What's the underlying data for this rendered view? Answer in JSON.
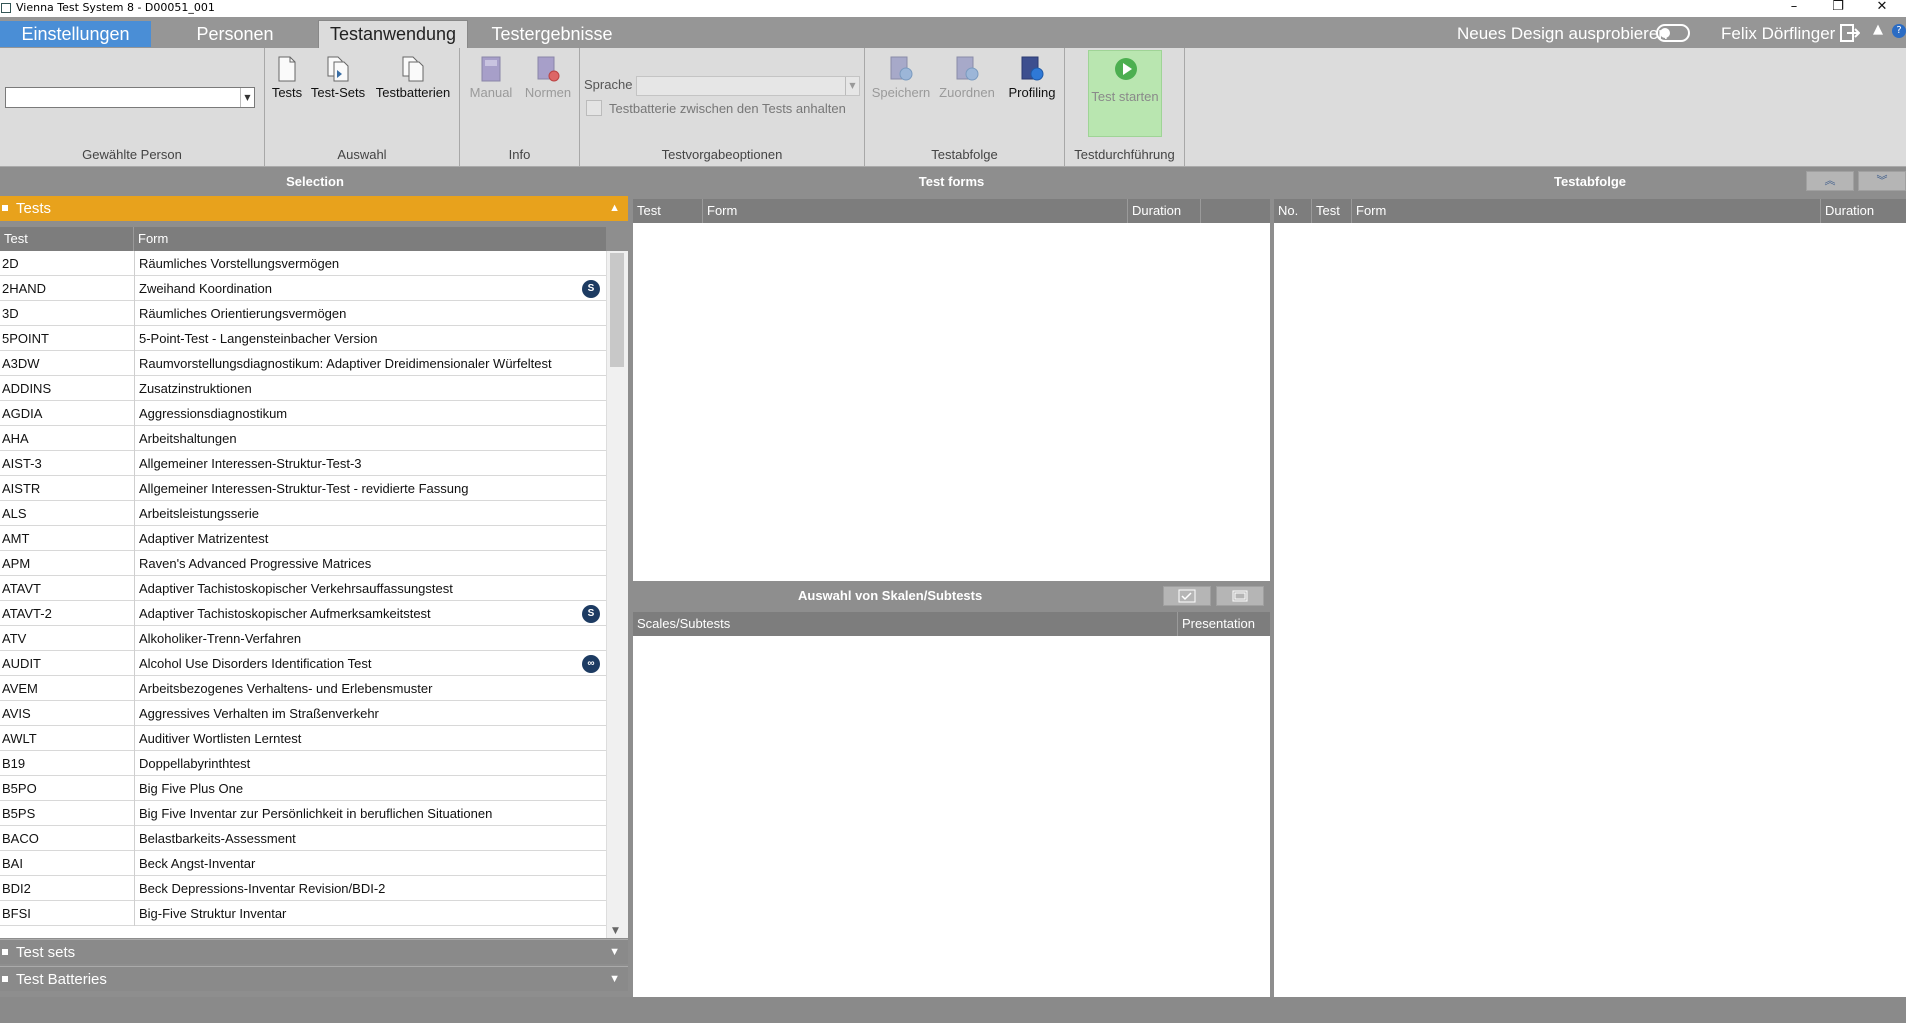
{
  "window": {
    "title": "Vienna Test System 8 - D00051_001",
    "minimize": "–",
    "restore": "❐",
    "close": "✕"
  },
  "tabs": {
    "settings": "Einstellungen",
    "persons": "Personen",
    "test_application": "Testanwendung",
    "results": "Testergebnisse"
  },
  "topright": {
    "new_design": "Neues Design ausprobieren",
    "user": "Felix Dörflinger",
    "logout_icon": "logout-icon",
    "help_icon": "?"
  },
  "ribbon": {
    "person": {
      "label": "Gewählte Person",
      "value": ""
    },
    "selection": {
      "label": "Auswahl",
      "tests": "Tests",
      "test_sets": "Test-Sets",
      "test_batteries": "Testbatterien"
    },
    "info": {
      "label": "Info",
      "manual": "Manual",
      "norms": "Normen"
    },
    "options": {
      "label": "Testvorgabeoptionen",
      "language_label": "Sprache",
      "language_value": "",
      "pause_label": "Testbatterie zwischen den Tests anhalten"
    },
    "sequence": {
      "label": "Testabfolge",
      "save": "Speichern",
      "assign": "Zuordnen",
      "profiling": "Profiling"
    },
    "execution": {
      "label": "Testdurchführung",
      "start": "Test starten"
    }
  },
  "selection_panel": {
    "header": "Selection",
    "tests_section": "Tests",
    "col_test": "Test",
    "col_form": "Form",
    "rows": [
      {
        "code": "2D",
        "form": "Räumliches Vorstellungsvermögen",
        "badge": ""
      },
      {
        "code": "2HAND",
        "form": "Zweihand Koordination",
        "badge": "S"
      },
      {
        "code": "3D",
        "form": "Räumliches Orientierungsvermögen",
        "badge": ""
      },
      {
        "code": "5POINT",
        "form": "5-Point-Test - Langensteinbacher Version",
        "badge": ""
      },
      {
        "code": "A3DW",
        "form": "Raumvorstellungsdiagnostikum: Adaptiver Dreidimensionaler Würfeltest",
        "badge": ""
      },
      {
        "code": "ADDINS",
        "form": "Zusatzinstruktionen",
        "badge": ""
      },
      {
        "code": "AGDIA",
        "form": "Aggressionsdiagnostikum",
        "badge": ""
      },
      {
        "code": "AHA",
        "form": "Arbeitshaltungen",
        "badge": ""
      },
      {
        "code": "AIST-3",
        "form": "Allgemeiner Interessen-Struktur-Test-3",
        "badge": ""
      },
      {
        "code": "AISTR",
        "form": "Allgemeiner Interessen-Struktur-Test - revidierte Fassung",
        "badge": ""
      },
      {
        "code": "ALS",
        "form": "Arbeitsleistungsserie",
        "badge": ""
      },
      {
        "code": "AMT",
        "form": "Adaptiver Matrizentest",
        "badge": ""
      },
      {
        "code": "APM",
        "form": "Raven's Advanced Progressive Matrices",
        "badge": ""
      },
      {
        "code": "ATAVT",
        "form": "Adaptiver Tachistoskopischer Verkehrsauffassungstest",
        "badge": ""
      },
      {
        "code": "ATAVT-2",
        "form": "Adaptiver Tachistoskopischer Aufmerksamkeitstest",
        "badge": "S"
      },
      {
        "code": "ATV",
        "form": "Alkoholiker-Trenn-Verfahren",
        "badge": ""
      },
      {
        "code": "AUDIT",
        "form": "Alcohol Use Disorders Identification Test",
        "badge": "∞"
      },
      {
        "code": "AVEM",
        "form": "Arbeitsbezogenes Verhaltens- und Erlebensmuster",
        "badge": ""
      },
      {
        "code": "AVIS",
        "form": "Aggressives Verhalten im Straßenverkehr",
        "badge": ""
      },
      {
        "code": "AWLT",
        "form": "Auditiver Wortlisten Lerntest",
        "badge": ""
      },
      {
        "code": "B19",
        "form": "Doppellabyrinthtest",
        "badge": ""
      },
      {
        "code": "B5PO",
        "form": "Big Five Plus One",
        "badge": ""
      },
      {
        "code": "B5PS",
        "form": "Big Five Inventar zur Persönlichkeit in beruflichen Situationen",
        "badge": ""
      },
      {
        "code": "BACO",
        "form": "Belastbarkeits-Assessment",
        "badge": ""
      },
      {
        "code": "BAI",
        "form": "Beck Angst-Inventar",
        "badge": ""
      },
      {
        "code": "BDI2",
        "form": "Beck Depressions-Inventar Revision/BDI-2",
        "badge": ""
      },
      {
        "code": "BFSI",
        "form": "Big-Five Struktur Inventar",
        "badge": ""
      }
    ],
    "test_sets_section": "Test sets",
    "test_batteries_section": "Test Batteries"
  },
  "test_forms_panel": {
    "header": "Test forms",
    "col_test": "Test",
    "col_form": "Form",
    "col_duration": "Duration"
  },
  "scales_panel": {
    "header": "Auswahl von Skalen/Subtests",
    "col_scales": "Scales/Subtests",
    "col_presentation": "Presentation"
  },
  "sequence_panel": {
    "header": "Testabfolge",
    "col_no": "No.",
    "col_test": "Test",
    "col_form": "Form",
    "col_duration": "Duration"
  }
}
